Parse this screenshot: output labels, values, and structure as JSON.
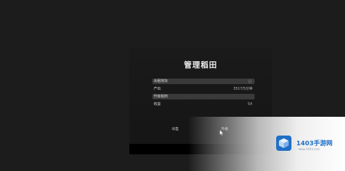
{
  "dialog": {
    "title": "管理稻田",
    "rows": [
      {
        "label": "出租地块",
        "icon": "info-icon",
        "value": ""
      },
      {
        "label": "产出",
        "value": "3517/5分钟"
      },
      {
        "label": "升级稻田",
        "value": ""
      },
      {
        "label": "收益",
        "value": "5/t"
      }
    ],
    "buttons": {
      "left": "出售",
      "right": "升级"
    }
  },
  "watermark": {
    "name": "1403手游网",
    "url": "www.1403.com"
  },
  "colors": {
    "background": "#1c1c1c",
    "dialog": "#171717",
    "row_highlight": "#3a3a3a",
    "watermark_blue": "#1f6fc7"
  }
}
